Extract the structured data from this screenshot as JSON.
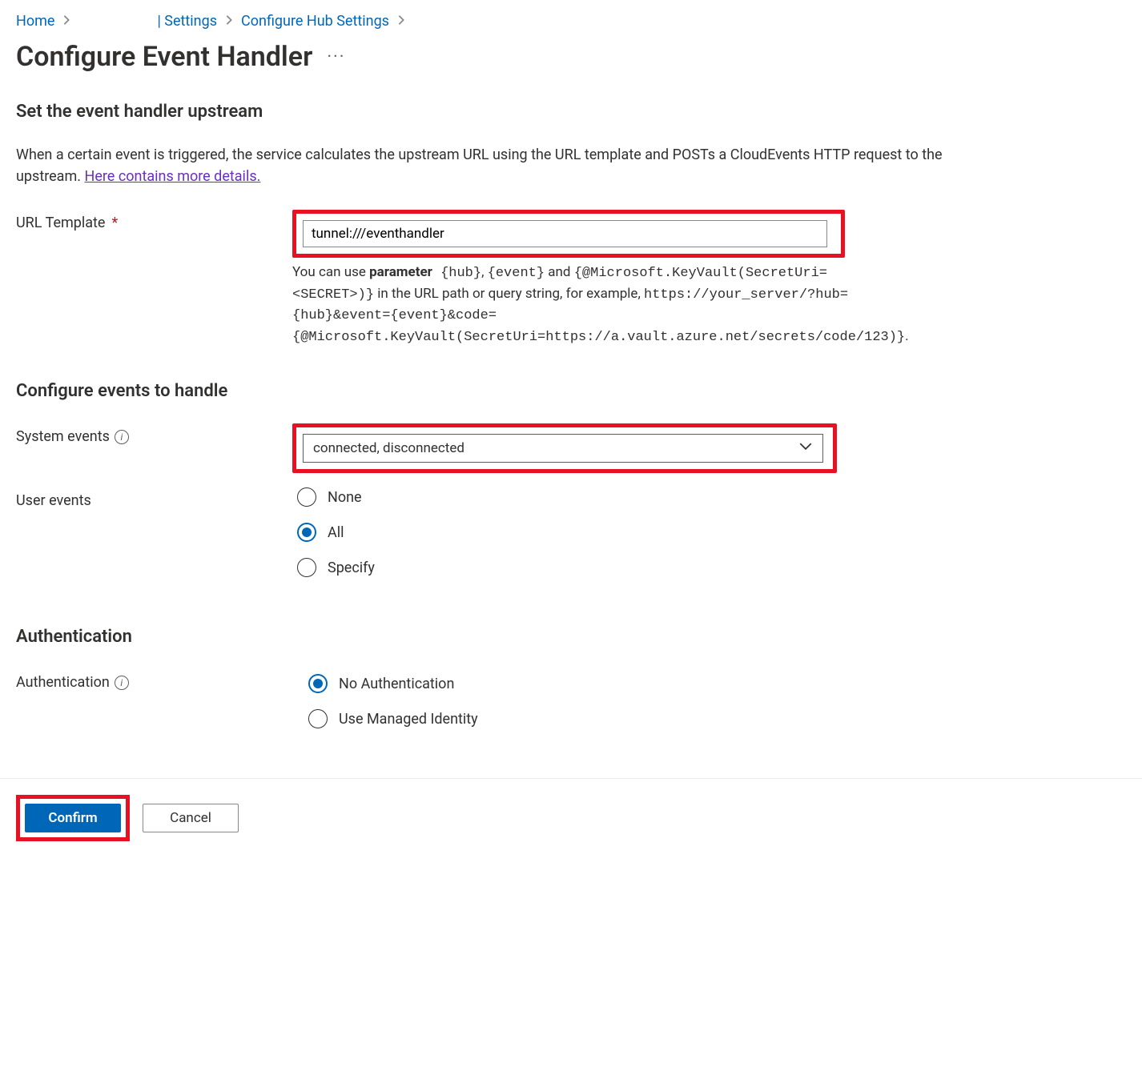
{
  "breadcrumb": {
    "home": "Home",
    "settings": "| Settings",
    "configure_hub": "Configure Hub Settings"
  },
  "page": {
    "title": "Configure Event Handler"
  },
  "upstream": {
    "heading": "Set the event handler upstream",
    "intro_text": "When a certain event is triggered, the service calculates the upstream URL using the URL template and POSTs a CloudEvents HTTP request to the upstream. ",
    "intro_link": "Here contains more details.",
    "url_template_label": "URL Template",
    "url_template_value": "tunnel:///eventhandler",
    "desc_pre": "You can use ",
    "desc_bold": "parameter",
    "desc_mono1": " {hub}",
    "desc_mid1": ", ",
    "desc_mono2": "{event}",
    "desc_mid2": " and ",
    "desc_mono3": "{@Microsoft.KeyVault(SecretUri=<SECRET>)}",
    "desc_mid3": " in the URL path or query string, for example, ",
    "desc_mono4": "https://your_server/?hub={hub}&event={event}&code={@Microsoft.KeyVault(SecretUri=https://a.vault.azure.net/secrets/code/123)}",
    "desc_end": "."
  },
  "events": {
    "heading": "Configure events to handle",
    "system_label": "System events",
    "system_value": "connected, disconnected",
    "user_label": "User events",
    "user_options": {
      "none": "None",
      "all": "All",
      "specify": "Specify"
    },
    "user_selected": "all"
  },
  "auth": {
    "heading": "Authentication",
    "label": "Authentication",
    "options": {
      "none": "No Authentication",
      "managed": "Use Managed Identity"
    },
    "selected": "none"
  },
  "footer": {
    "confirm": "Confirm",
    "cancel": "Cancel"
  }
}
